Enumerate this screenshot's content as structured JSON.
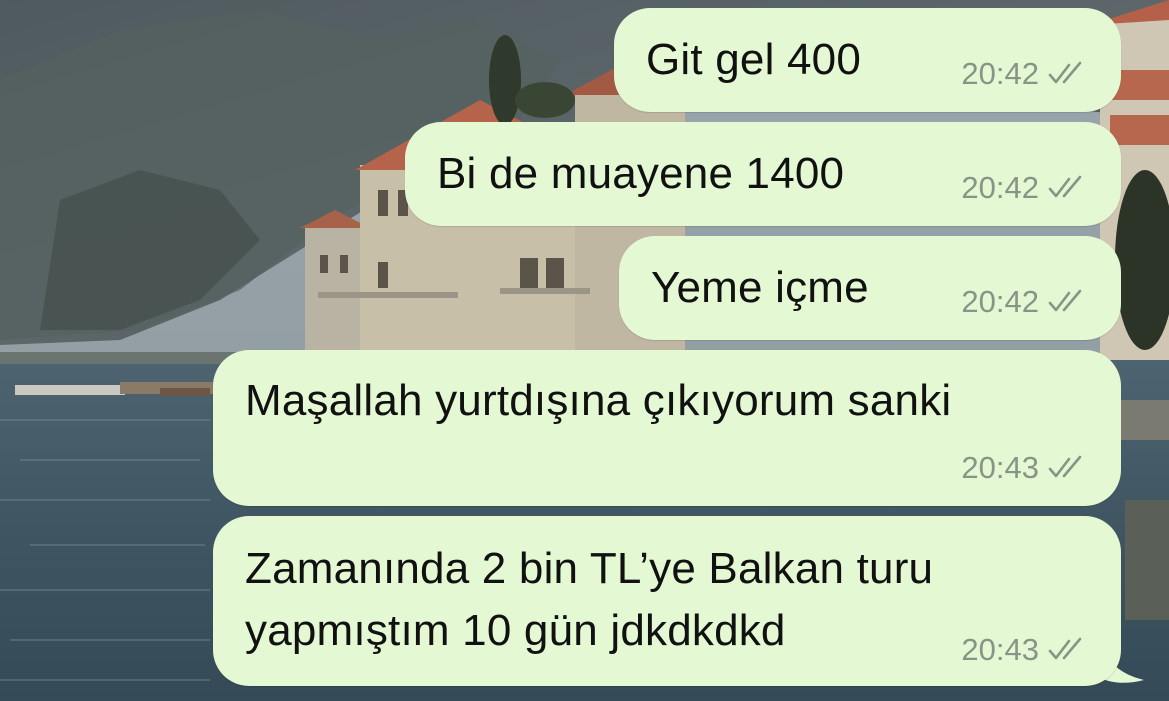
{
  "chat": {
    "messages": [
      {
        "text": "Git gel 400",
        "time": "20:42",
        "status": "delivered"
      },
      {
        "text": "Bi de muayene 1400",
        "time": "20:42",
        "status": "delivered"
      },
      {
        "text": "Yeme içme",
        "time": "20:42",
        "status": "delivered"
      },
      {
        "text": "Maşallah yurtdışına çıkıyorum sanki",
        "time": "20:43",
        "status": "delivered"
      },
      {
        "text": "Zamanında 2 bin TL’ye Balkan turu\nyapmıştım 10 gün jdkdkdkd",
        "time": "20:43",
        "status": "delivered"
      }
    ]
  },
  "colors": {
    "outgoing_bubble": "#e4f8d4",
    "timestamp": "#8a9486",
    "tick": "#8a9486"
  },
  "icons": {
    "status": "double-check-icon",
    "background": "lakeside-town-photo"
  }
}
